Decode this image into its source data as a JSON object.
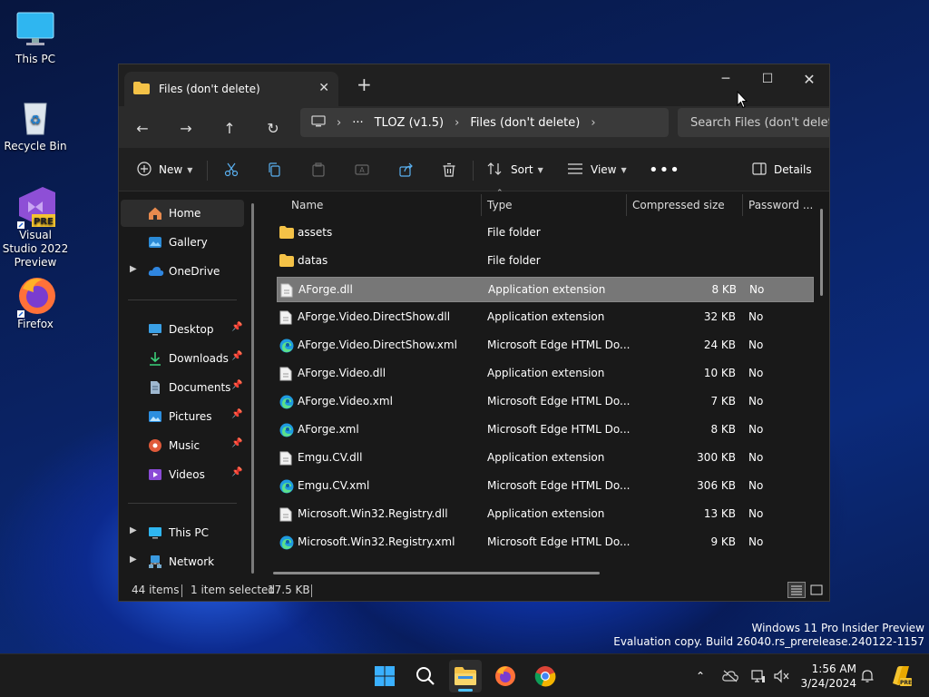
{
  "desktop": {
    "icons": [
      {
        "label": "This PC"
      },
      {
        "label": "Recycle Bin"
      },
      {
        "label": "Visual Studio 2022 Preview",
        "badge": "PRE"
      },
      {
        "label": "Firefox"
      }
    ],
    "watermark": {
      "line1": "Windows 11 Pro Insider Preview",
      "line2": "Evaluation copy. Build 26040.rs_prerelease.240122-1157"
    }
  },
  "window": {
    "tab_title": "Files (don't delete)",
    "breadcrumb": [
      "TLOZ (v1.5)",
      "Files (don't delete)"
    ],
    "search_placeholder": "Search Files (don't delete)",
    "commands": {
      "new": "New",
      "sort": "Sort",
      "view": "View",
      "details": "Details"
    },
    "nav": {
      "home": "Home",
      "gallery": "Gallery",
      "onedrive": "OneDrive",
      "desktop": "Desktop",
      "downloads": "Downloads",
      "documents": "Documents",
      "pictures": "Pictures",
      "music": "Music",
      "videos": "Videos",
      "thispc": "This PC",
      "network": "Network"
    },
    "columns": {
      "name": "Name",
      "type": "Type",
      "size": "Compressed size",
      "password": "Password ..."
    },
    "files": [
      {
        "name": "assets",
        "type": "File folder",
        "size": "",
        "password": "",
        "kind": "folder"
      },
      {
        "name": "datas",
        "type": "File folder",
        "size": "",
        "password": "",
        "kind": "folder"
      },
      {
        "name": "AForge.dll",
        "type": "Application extension",
        "size": "8 KB",
        "password": "No",
        "kind": "dll"
      },
      {
        "name": "AForge.Video.DirectShow.dll",
        "type": "Application extension",
        "size": "32 KB",
        "password": "No",
        "kind": "dll"
      },
      {
        "name": "AForge.Video.DirectShow.xml",
        "type": "Microsoft Edge HTML Do...",
        "size": "24 KB",
        "password": "No",
        "kind": "edge"
      },
      {
        "name": "AForge.Video.dll",
        "type": "Application extension",
        "size": "10 KB",
        "password": "No",
        "kind": "dll"
      },
      {
        "name": "AForge.Video.xml",
        "type": "Microsoft Edge HTML Do...",
        "size": "7 KB",
        "password": "No",
        "kind": "edge"
      },
      {
        "name": "AForge.xml",
        "type": "Microsoft Edge HTML Do...",
        "size": "8 KB",
        "password": "No",
        "kind": "edge"
      },
      {
        "name": "Emgu.CV.dll",
        "type": "Application extension",
        "size": "300 KB",
        "password": "No",
        "kind": "dll"
      },
      {
        "name": "Emgu.CV.xml",
        "type": "Microsoft Edge HTML Do...",
        "size": "306 KB",
        "password": "No",
        "kind": "edge"
      },
      {
        "name": "Microsoft.Win32.Registry.dll",
        "type": "Application extension",
        "size": "13 KB",
        "password": "No",
        "kind": "dll"
      },
      {
        "name": "Microsoft.Win32.Registry.xml",
        "type": "Microsoft Edge HTML Do...",
        "size": "9 KB",
        "password": "No",
        "kind": "edge"
      }
    ],
    "selected_index": 2,
    "status": {
      "count": "44 items",
      "selection": "1 item selected",
      "size": "17.5 KB"
    }
  },
  "taskbar": {
    "time": "1:56 AM",
    "date": "3/24/2024",
    "tray_badge": "PRE"
  }
}
